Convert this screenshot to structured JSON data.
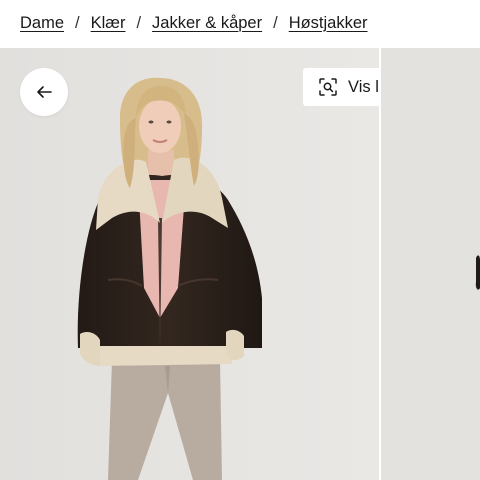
{
  "breadcrumb": {
    "items": [
      "Dame",
      "Klær",
      "Jakker & kåper",
      "Høstjakker"
    ],
    "separator": "/"
  },
  "gallery": {
    "back_icon": "arrow-left-icon",
    "similar_button": {
      "label": "Vis lignende",
      "icon": "visual-search-icon"
    }
  },
  "colors": {
    "text": "#1a1a1a",
    "image_background": "#e7e5e2",
    "jacket": "#2b211d",
    "shearling": "#e6dac4"
  }
}
